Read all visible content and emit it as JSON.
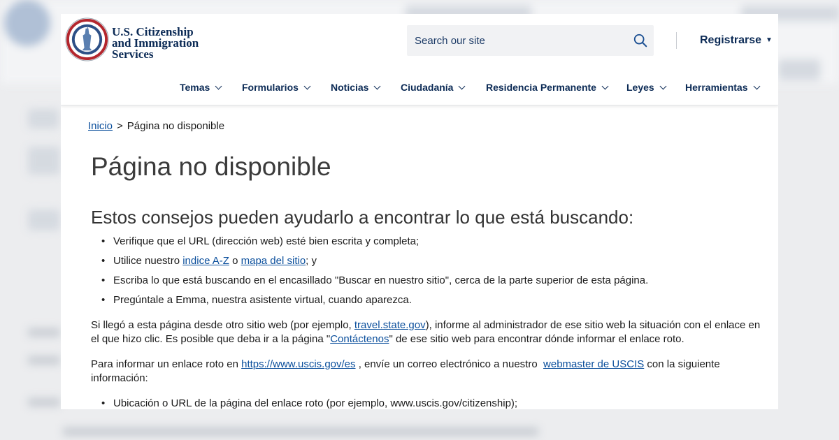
{
  "brand": {
    "line1": "U.S. Citizenship",
    "line2": "and Immigration",
    "line3": "Services"
  },
  "search": {
    "placeholder": "Search our site"
  },
  "account": {
    "register_label": "Registrarse"
  },
  "nav": [
    {
      "label": "Temas"
    },
    {
      "label": "Formularios"
    },
    {
      "label": "Noticias"
    },
    {
      "label": "Ciudadanía"
    },
    {
      "label": "Residencia Permanente"
    },
    {
      "label": "Leyes"
    },
    {
      "label": "Herramientas"
    }
  ],
  "breadcrumb": {
    "home": "Inicio",
    "separator": ">",
    "current": "Página no disponible"
  },
  "page_title": "Página no disponible",
  "tips": {
    "heading": "Estos consejos pueden ayudarlo a encontrar lo que está buscando:",
    "item1": "Verifique que el URL (dirección web) esté bien escrita y completa;",
    "item2_pre": "Utilice nuestro ",
    "item2_link1": "indice A-Z",
    "item2_mid": " o ",
    "item2_link2": "mapa del sitio",
    "item2_post": "; y",
    "item3": "Escriba lo que está buscando en el encasillado \"Buscar en nuestro sitio\", cerca de la parte superior de esta página.",
    "item4": "Pregúntale a Emma, nuestra asistente virtual, cuando aparezca."
  },
  "para1": {
    "pre": "Si llegó a esta página desde otro sitio web (por ejemplo, ",
    "link1": "travel.state.gov",
    "mid": "), informe al administrador de ese sitio web la situación con el enlace en el que hizo clic. Es posible que deba ir a la página \"",
    "link2": "Contáctenos",
    "post": "\" de ese sitio web para encontrar dónde informar el enlace roto."
  },
  "para2": {
    "pre": "Para informar un enlace roto en ",
    "link1": "https://www.uscis.gov/es",
    "mid": " , envíe un correo electrónico a nuestro  ",
    "link2": "webmaster de USCIS",
    "post": " con la siguiente información:"
  },
  "info_item1": "Ubicación o URL de la página del enlace roto (por ejemplo, www.uscis.gov/citizenship);",
  "colors": {
    "navy": "#0b2a55",
    "link": "#0b4f9c",
    "background": "#ecedef"
  },
  "icons": {
    "search": "search-icon",
    "seal": "dhs-seal-icon",
    "caret": "caret-down-icon"
  }
}
